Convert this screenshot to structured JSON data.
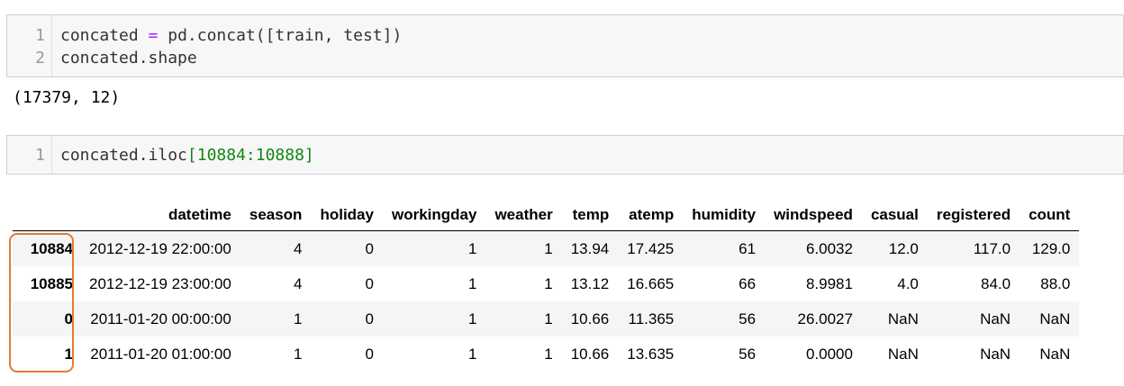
{
  "cells": [
    {
      "lines": [
        {
          "no": "1",
          "tokens": [
            {
              "t": "concated ",
              "c": ""
            },
            {
              "t": "=",
              "c": "op"
            },
            {
              "t": " pd.concat([train, test])",
              "c": ""
            }
          ]
        },
        {
          "no": "2",
          "tokens": [
            {
              "t": "concated.shape",
              "c": ""
            }
          ]
        }
      ],
      "output": "(17379, 12)"
    },
    {
      "lines": [
        {
          "no": "1",
          "tokens": [
            {
              "t": "concated.iloc",
              "c": ""
            },
            {
              "t": "[10884:10888]",
              "c": "num"
            }
          ]
        }
      ]
    }
  ],
  "dataframe": {
    "columns": [
      "",
      "datetime",
      "season",
      "holiday",
      "workingday",
      "weather",
      "temp",
      "atemp",
      "humidity",
      "windspeed",
      "casual",
      "registered",
      "count"
    ],
    "rows": [
      {
        "index": "10884",
        "values": [
          "2012-12-19 22:00:00",
          "4",
          "0",
          "1",
          "1",
          "13.94",
          "17.425",
          "61",
          "6.0032",
          "12.0",
          "117.0",
          "129.0"
        ]
      },
      {
        "index": "10885",
        "values": [
          "2012-12-19 23:00:00",
          "4",
          "0",
          "1",
          "1",
          "13.12",
          "16.665",
          "66",
          "8.9981",
          "4.0",
          "84.0",
          "88.0"
        ]
      },
      {
        "index": "0",
        "values": [
          "2011-01-20 00:00:00",
          "1",
          "0",
          "1",
          "1",
          "10.66",
          "11.365",
          "56",
          "26.0027",
          "NaN",
          "NaN",
          "NaN"
        ]
      },
      {
        "index": "1",
        "values": [
          "2011-01-20 01:00:00",
          "1",
          "0",
          "1",
          "1",
          "10.66",
          "13.635",
          "56",
          "0.0000",
          "NaN",
          "NaN",
          "NaN"
        ]
      }
    ]
  },
  "colors": {
    "highlight_border": "#e07b39",
    "keyword_op": "#aa22ff",
    "number_literal": "#118811"
  }
}
